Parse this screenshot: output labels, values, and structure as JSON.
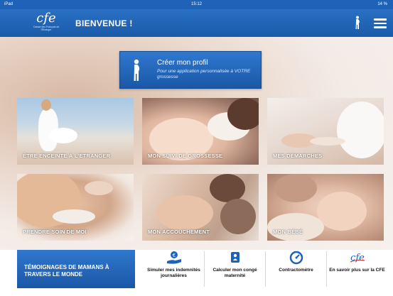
{
  "status": {
    "device": "iPad",
    "time": "15:12",
    "battery": "14 %"
  },
  "header": {
    "logo_mark": "cfe",
    "logo_sub": "Caisse des Français de l'Étranger",
    "title": "BIENVENUE !"
  },
  "profile": {
    "title": "Créer mon profil",
    "subtitle": "Pour une application personnalisée à VOTRE grossesse"
  },
  "tiles": [
    {
      "label": "ÊTRE ENCEINTE À L'ÉTRANGER"
    },
    {
      "label": "MON SUIVI DE GROSSESSE"
    },
    {
      "label": "MES DÉMARCHES"
    },
    {
      "label": "PRENDRE SOIN DE MOI"
    },
    {
      "label": "MON ACCOUCHEMENT"
    },
    {
      "label": "MON BÉBÉ"
    }
  ],
  "bottom": {
    "testimonials": "TÉMOIGNAGES DE MAMANS À TRAVERS LE MONDE",
    "items": [
      {
        "label": "Simuler mes indemnités journalières",
        "icon": "euro-hand-icon"
      },
      {
        "label": "Calculer mon congé maternité",
        "icon": "calendar-person-icon"
      },
      {
        "label": "Contractomètre",
        "icon": "gauge-icon"
      },
      {
        "label": "En savoir plus sur la CFE",
        "icon": "cfe-logo-icon"
      }
    ]
  },
  "colors": {
    "brand_blue": "#1e63b8",
    "button_blue": "#2f78cf",
    "white": "#ffffff"
  }
}
